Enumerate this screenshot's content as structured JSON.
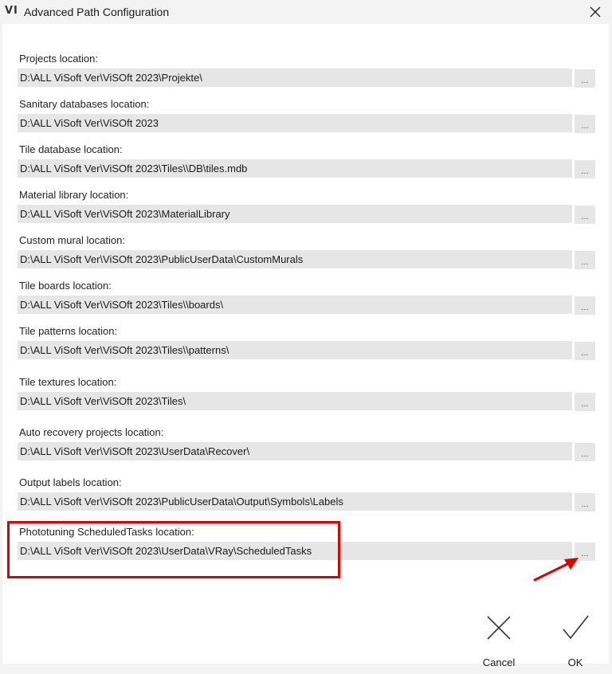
{
  "window": {
    "logo_text": "VI",
    "title": "Advanced Path Configuration"
  },
  "paths": [
    {
      "label": "Projects location:",
      "value": "D:\\ALL ViSoft Ver\\ViSOft 2023\\Projekte\\",
      "browse": "..."
    },
    {
      "label": "Sanitary databases location:",
      "value": "D:\\ALL ViSoft Ver\\ViSOft 2023",
      "browse": "..."
    },
    {
      "label": "Tile database location:",
      "value": "D:\\ALL ViSoft Ver\\ViSOft 2023\\Tiles\\\\DB\\tiles.mdb",
      "browse": "..."
    },
    {
      "label": "Material library location:",
      "value": "D:\\ALL ViSoft Ver\\ViSOft 2023\\MaterialLibrary",
      "browse": "..."
    },
    {
      "label": "Custom mural location:",
      "value": "D:\\ALL ViSoft Ver\\ViSOft 2023\\PublicUserData\\CustomMurals",
      "browse": "..."
    },
    {
      "label": "Tile boards location:",
      "value": "D:\\ALL ViSoft Ver\\ViSOft 2023\\Tiles\\\\boards\\",
      "browse": "..."
    },
    {
      "label": "Tile patterns location:",
      "value": "D:\\ALL ViSoft Ver\\ViSOft 2023\\Tiles\\\\patterns\\",
      "browse": "..."
    },
    {
      "label": "Tile textures location:",
      "value": "D:\\ALL ViSoft Ver\\ViSOft 2023\\Tiles\\",
      "browse": "..."
    },
    {
      "label": "Auto recovery projects location:",
      "value": "D:\\ALL ViSoft Ver\\ViSOft 2023\\UserData\\Recover\\",
      "browse": "..."
    },
    {
      "label": "Output labels location:",
      "value": "D:\\ALL ViSoft Ver\\ViSOft 2023\\PublicUserData\\Output\\Symbols\\Labels",
      "browse": "..."
    },
    {
      "label": "Phototuning ScheduledTasks location:",
      "value": "D:\\ALL ViSoft Ver\\ViSOft 2023\\UserData\\VRay\\ScheduledTasks",
      "browse": "..."
    }
  ],
  "actions": {
    "cancel_label": "Cancel",
    "ok_label": "OK"
  },
  "colors": {
    "highlight": "#e00000",
    "field_bg": "#e6e6e6"
  },
  "icons": {
    "close": "close-icon",
    "cancel": "x-icon",
    "ok": "checkmark-icon",
    "annotation": "red-arrow-icon"
  }
}
